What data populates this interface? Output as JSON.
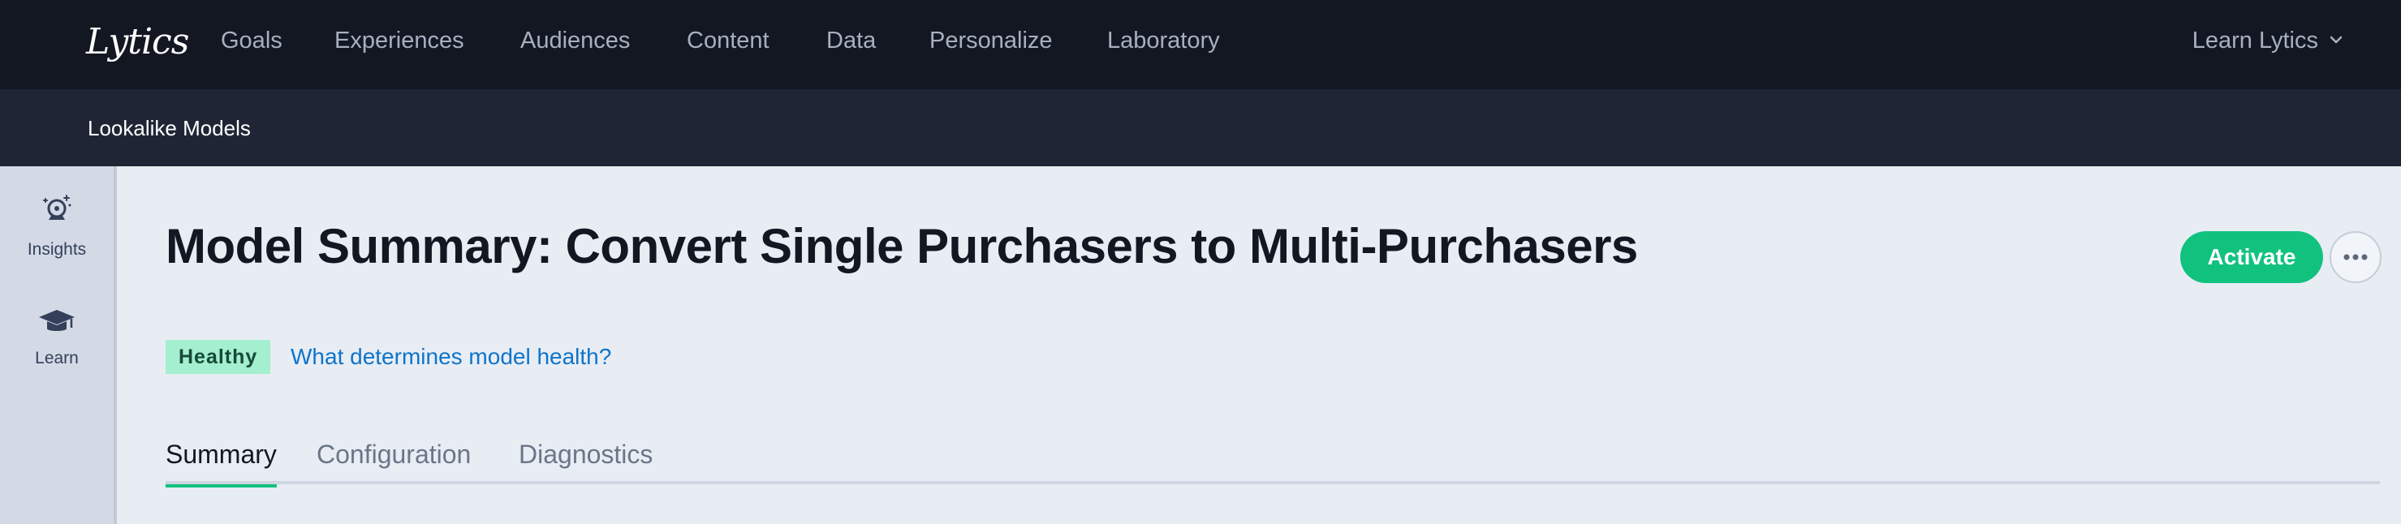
{
  "app": {
    "logo_text": "Lytics",
    "nav": [
      {
        "label": "Goals"
      },
      {
        "label": "Experiences"
      },
      {
        "label": "Audiences"
      },
      {
        "label": "Content"
      },
      {
        "label": "Data"
      },
      {
        "label": "Personalize"
      },
      {
        "label": "Laboratory"
      }
    ],
    "account_label": "Learn Lytics"
  },
  "subnav": {
    "items": [
      {
        "label": "Lookalike Models"
      }
    ]
  },
  "sidebar": {
    "items": [
      {
        "label": "Insights",
        "icon": "crystal-ball-icon"
      },
      {
        "label": "Learn",
        "icon": "graduation-cap-icon"
      }
    ]
  },
  "page": {
    "title": "Model Summary: Convert Single Purchasers to Multi-Purchasers",
    "activate_label": "Activate",
    "health_status": "Healthy",
    "health_link": "What determines model health?",
    "tabs": [
      {
        "label": "Summary",
        "active": true
      },
      {
        "label": "Configuration",
        "active": false
      },
      {
        "label": "Diagnostics",
        "active": false
      }
    ]
  },
  "colors": {
    "topnav_bg": "#131722",
    "subnav_bg": "#1f2534",
    "accent": "#11c27f",
    "link": "#0f74c9",
    "badge_bg": "#a3efcf"
  }
}
